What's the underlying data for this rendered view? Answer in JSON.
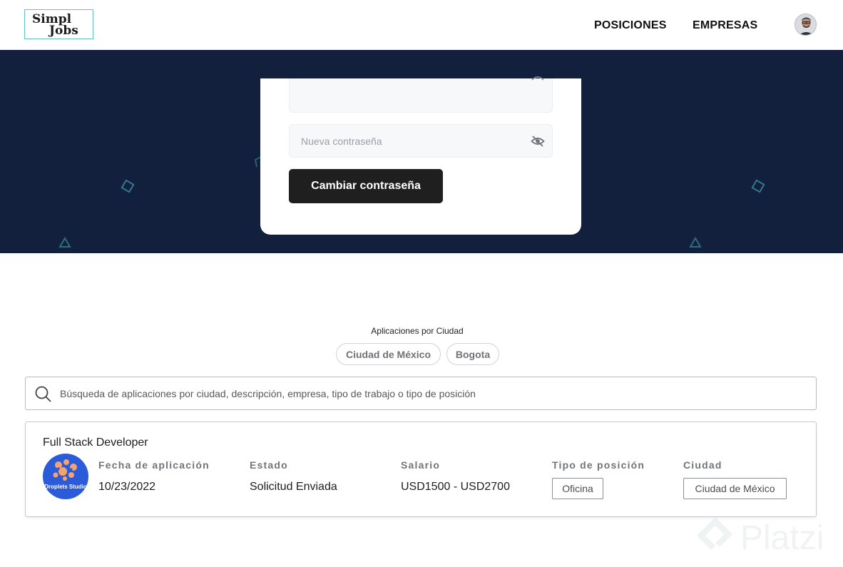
{
  "header": {
    "logo_line1": "Simpl",
    "logo_line2": "Jobs",
    "nav": [
      "POSICIONES",
      "EMPRESAS"
    ]
  },
  "password_card": {
    "new_password_placeholder": "Nueva contraseña",
    "submit_label": "Cambiar contraseña"
  },
  "filters": {
    "title": "Aplicaciones por Ciudad",
    "cities": [
      "Ciudad de México",
      "Bogota"
    ]
  },
  "search": {
    "placeholder": "Búsqueda de aplicaciones por ciudad, descripción, empresa, tipo de trabajo o tipo de posición"
  },
  "applications": [
    {
      "title": "Full Stack Developer",
      "company_logo_text": "Droplets Studio",
      "columns": {
        "date_label": "Fecha de aplicación",
        "date": "10/23/2022",
        "status_label": "Estado",
        "status": "Solicitud Enviada",
        "salary_label": "Salario",
        "salary": "USD1500 - USD2700",
        "position_type_label": "Tipo de posición",
        "position_type": "Oficina",
        "city_label": "Ciudad",
        "city": "Ciudad de México"
      }
    }
  ],
  "watermark": "Platzi",
  "colors": {
    "hero_background": "#121f3d",
    "button_background": "#1f1f1f",
    "logo_accent": "#5fc6c8",
    "company_logo_background": "#2b5bd8"
  },
  "icons": [
    "eye-off-icon",
    "search-icon",
    "avatar-image",
    "droplets-logo"
  ]
}
